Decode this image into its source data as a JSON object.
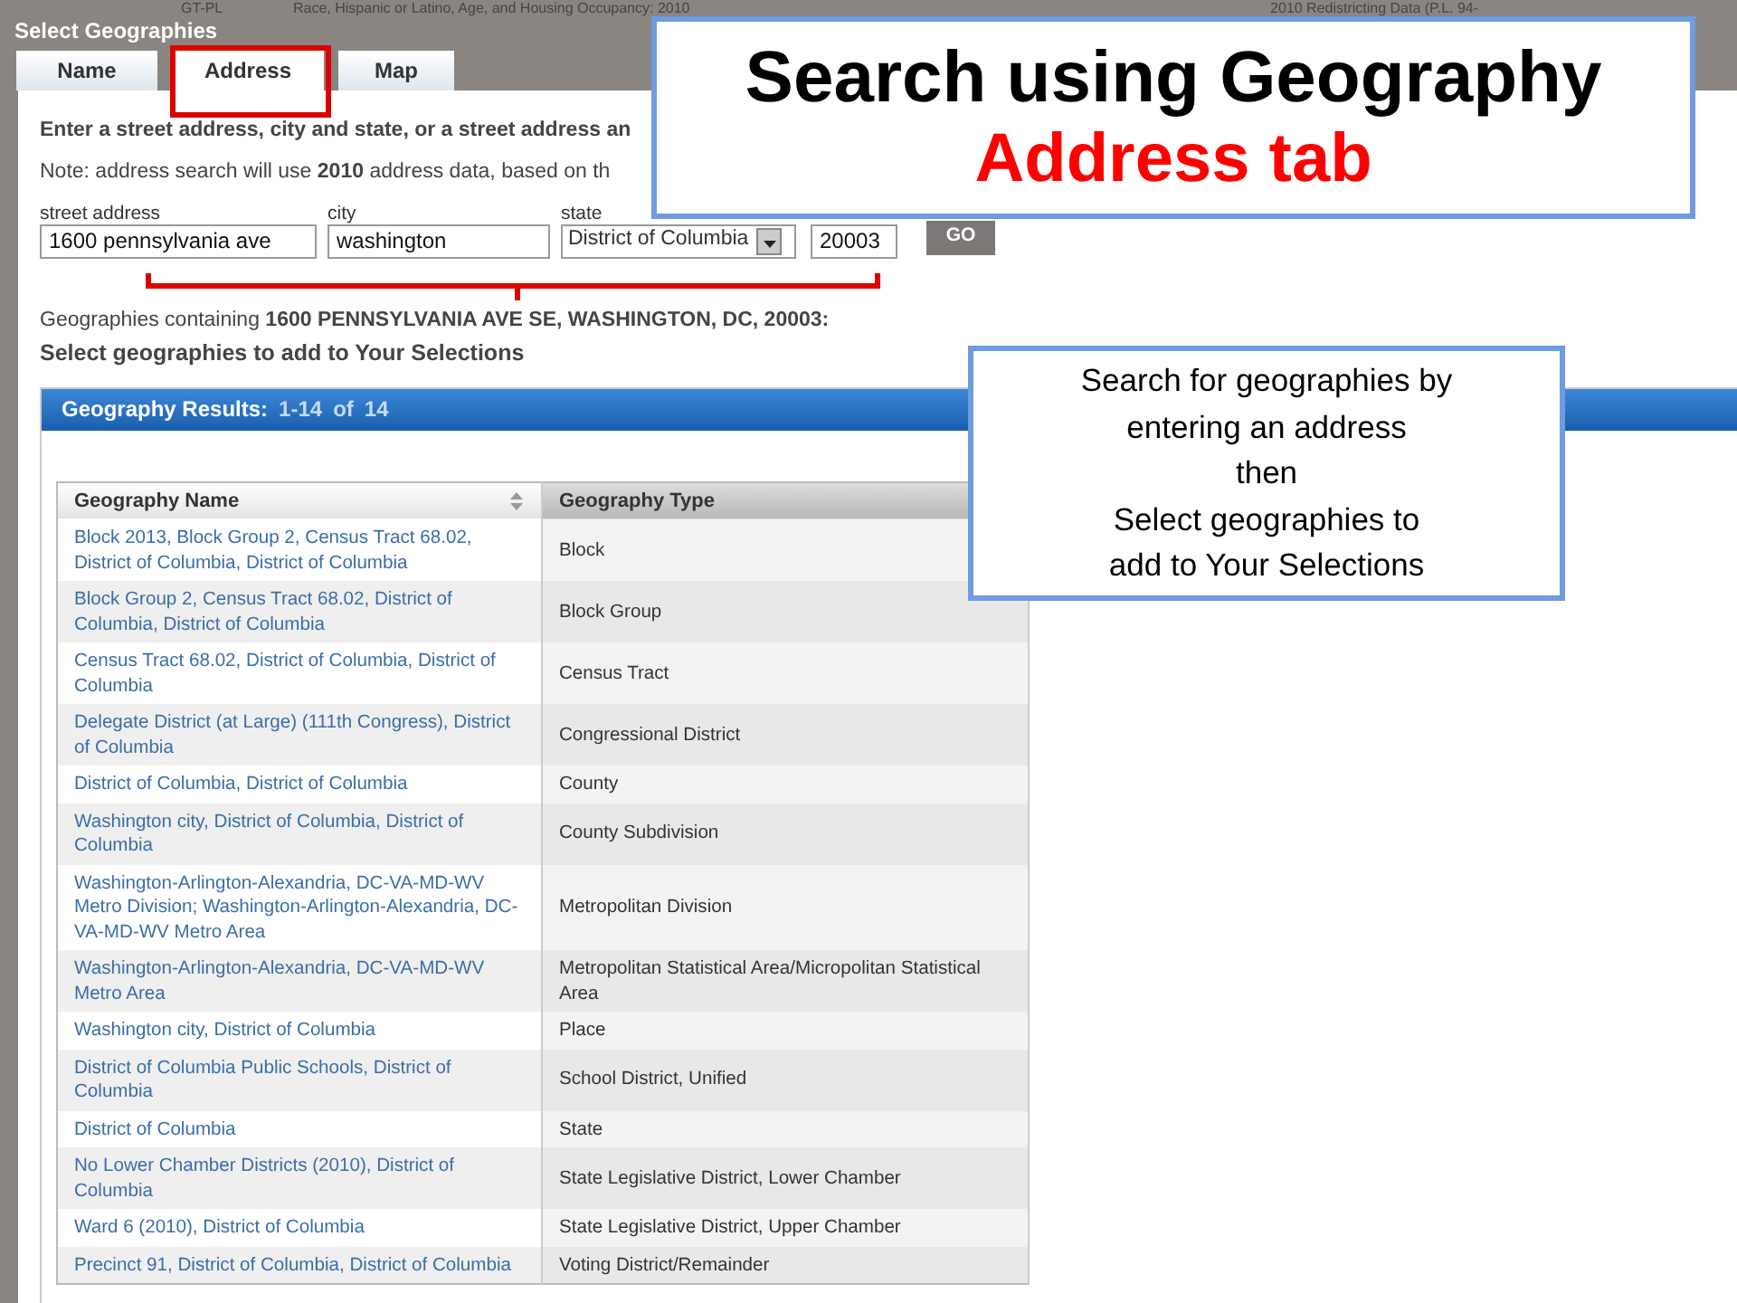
{
  "backdrop": {
    "texts": [
      "GT-PL",
      "Race, Hispanic or Latino, Age, and Housing Occupancy: 2010",
      "2010 Redistricting Data (P.L. 94-"
    ]
  },
  "dialog": {
    "title": "Select Geographies",
    "tabs": [
      {
        "label": "Name",
        "selected": false
      },
      {
        "label": "Address",
        "selected": true
      },
      {
        "label": "Map",
        "selected": false
      }
    ],
    "instructions": "Enter a street address, city and state, or a street address an",
    "note": "Note: address search will use **2010** address data, based on th",
    "fields": [
      {
        "kind": "text",
        "label": "street address",
        "value": "1600 pennsylvania ave"
      },
      {
        "kind": "text",
        "label": "city",
        "value": "washington"
      },
      {
        "kind": "select",
        "label": "state",
        "value": "District of Columbia"
      },
      {
        "kind": "text",
        "value": "20003"
      }
    ],
    "go_button": "GO",
    "result_line": "Geographies containing **1600 PENNSYLVANIA AVE SE, WASHINGTON, DC, 20003:**",
    "select_prompt": "Select geographies to add to Your Selections",
    "results": {
      "title": "Geography Results:",
      "range": "1-14",
      "of": "of",
      "total": "14",
      "table": {
        "columns": [
          {
            "label": "Geography Name",
            "sortable": true
          },
          {
            "label": "Geography Type",
            "sortable": false
          }
        ],
        "rows": [
          {
            "name": "Block 2013, Block Group 2, Census Tract 68.02, District of Columbia, District of Columbia",
            "type": "Block"
          },
          {
            "name": "Block Group 2, Census Tract 68.02, District of Columbia, District of Columbia",
            "type": "Block Group"
          },
          {
            "name": "Census Tract 68.02, District of Columbia, District of Columbia",
            "type": "Census Tract"
          },
          {
            "name": "Delegate District (at Large) (111th Congress), District of Columbia",
            "type": "Congressional District"
          },
          {
            "name": "District of Columbia, District of Columbia",
            "type": "County"
          },
          {
            "name": "Washington city, District of Columbia, District of Columbia",
            "type": "County Subdivision"
          },
          {
            "name": "Washington-Arlington-Alexandria, DC-VA-MD-WV Metro Division; Washington-Arlington-Alexandria, DC-VA-MD-WV Metro Area",
            "type": "Metropolitan Division"
          },
          {
            "name": "Washington-Arlington-Alexandria, DC-VA-MD-WV Metro Area",
            "type": "Metropolitan Statistical Area/Micropolitan Statistical Area"
          },
          {
            "name": "Washington city, District of Columbia",
            "type": "Place"
          },
          {
            "name": "District of Columbia Public Schools, District of Columbia",
            "type": "School District, Unified"
          },
          {
            "name": "District of Columbia",
            "type": "State"
          },
          {
            "name": "No Lower Chamber Districts (2010), District of Columbia",
            "type": "State Legislative District, Lower Chamber"
          },
          {
            "name": "Ward 6 (2010), District of Columbia",
            "type": "State Legislative District, Upper Chamber"
          },
          {
            "name": "Precinct 91, District of Columbia, District of Columbia",
            "type": "Voting District/Remainder"
          }
        ]
      }
    }
  },
  "annotations": {
    "title": "Search using Geography",
    "subtitle": "Address tab",
    "note_lines": [
      "Search for geographies by",
      "entering an address",
      "then",
      "Select geographies to",
      "add to Your Selections"
    ]
  }
}
